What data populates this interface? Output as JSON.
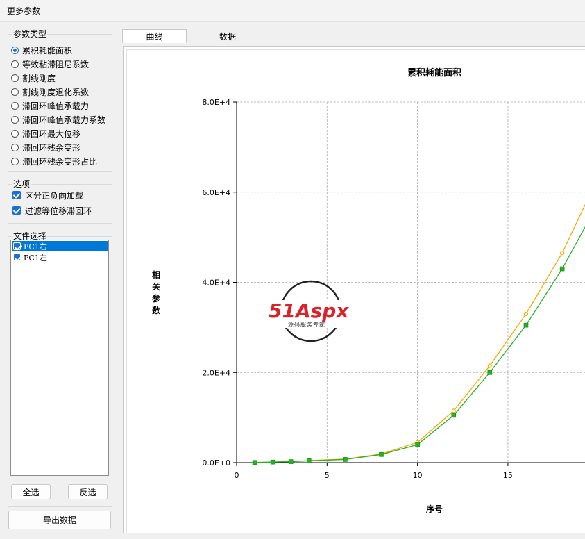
{
  "window": {
    "title": "更多参数"
  },
  "param_group": {
    "label": "参数类型",
    "selected_index": 0,
    "options": [
      "累积耗能面积",
      "等效粘滞阻尼系数",
      "割线刚度",
      "割线刚度退化系数",
      "滞回环峰值承载力",
      "滞回环峰值承载力系数",
      "滞回环最大位移",
      "滞回环残余变形",
      "滞回环残余变形占比"
    ]
  },
  "options_group": {
    "label": "选项",
    "items": [
      {
        "label": "区分正负向加载",
        "checked": true
      },
      {
        "label": "过滤等位移滞回环",
        "checked": true
      }
    ]
  },
  "file_group": {
    "label": "文件选择",
    "files": [
      {
        "label": "PC1右",
        "checked": true,
        "selected": true
      },
      {
        "label": "PC1左",
        "checked": true,
        "selected": false
      }
    ],
    "select_all_label": "全选",
    "invert_label": "反选"
  },
  "export_label": "导出数据",
  "tabs": [
    {
      "label": "曲线",
      "active": true
    },
    {
      "label": "数据",
      "active": false
    }
  ],
  "watermark": {
    "brand": "51Aspx",
    "tagline": "源码服务专家"
  },
  "chart_data": {
    "type": "line",
    "title": "累积耗能面积",
    "xlabel": "序号",
    "ylabel": "相关参数",
    "xlim": [
      0,
      19.3
    ],
    "ylim": [
      0,
      80000
    ],
    "xticks": [
      0,
      5,
      10,
      15
    ],
    "yticks": [
      0,
      20000,
      40000,
      60000,
      80000
    ],
    "ytick_labels": [
      "0.0E+0",
      "2.0E+4",
      "4.0E+4",
      "6.0E+4",
      "8.0E+4"
    ],
    "grid": true,
    "series": [
      {
        "color": "#f5a800",
        "marker": "circle",
        "x": [
          1,
          2,
          3,
          4,
          6,
          8,
          10,
          12,
          14,
          16,
          18,
          19.3
        ],
        "y": [
          50,
          150,
          250,
          450,
          800,
          1900,
          4500,
          11500,
          21500,
          33000,
          46500,
          57500
        ]
      },
      {
        "color": "#22b522",
        "marker": "square",
        "x": [
          1,
          2,
          3,
          4,
          6,
          8,
          10,
          12,
          14,
          16,
          18,
          19.3
        ],
        "y": [
          40,
          130,
          220,
          400,
          700,
          1800,
          4000,
          10500,
          20000,
          30500,
          43000,
          52500
        ]
      }
    ]
  }
}
